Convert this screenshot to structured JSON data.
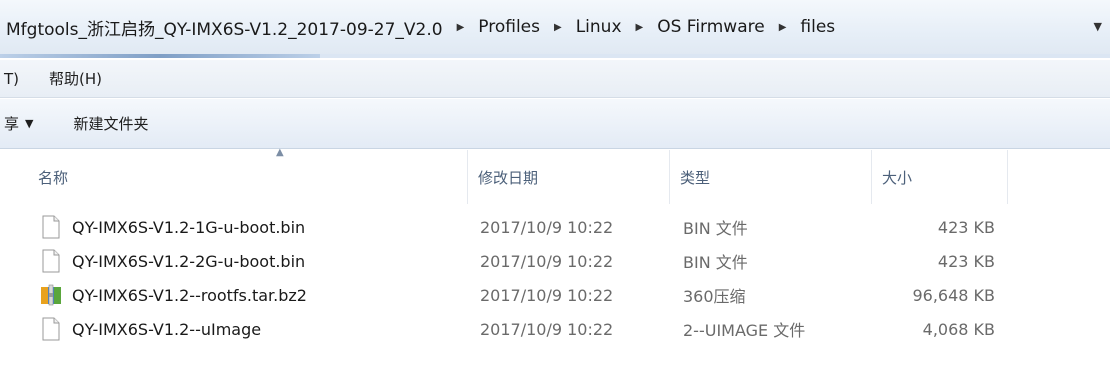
{
  "address": {
    "crumbs": [
      "Mfgtools_浙江启扬_QY-IMX6S-V1.2_2017-09-27_V2.0",
      "Profiles",
      "Linux",
      "OS Firmware",
      "files"
    ],
    "separator": "▶",
    "dropdown": "▼"
  },
  "menubar": {
    "items": [
      "T)",
      "帮助(H)"
    ]
  },
  "toolbar": {
    "share_label": "享",
    "share_caret": "▼",
    "new_folder_label": "新建文件夹"
  },
  "headers": {
    "name": "名称",
    "date": "修改日期",
    "type": "类型",
    "size": "大小",
    "sort_indicator": "▲"
  },
  "files": [
    {
      "name": "QY-IMX6S-V1.2-1G-u-boot.bin",
      "date": "2017/10/9 10:22",
      "type": "BIN 文件",
      "size": "423 KB",
      "icon": "file-icon"
    },
    {
      "name": "QY-IMX6S-V1.2-2G-u-boot.bin",
      "date": "2017/10/9 10:22",
      "type": "BIN 文件",
      "size": "423 KB",
      "icon": "file-icon"
    },
    {
      "name": "QY-IMX6S-V1.2--rootfs.tar.bz2",
      "date": "2017/10/9 10:22",
      "type": "360压缩",
      "size": "96,648 KB",
      "icon": "archive-icon"
    },
    {
      "name": "QY-IMX6S-V1.2--uImage",
      "date": "2017/10/9 10:22",
      "type": "2--UIMAGE 文件",
      "size": "4,068 KB",
      "icon": "file-icon"
    }
  ]
}
